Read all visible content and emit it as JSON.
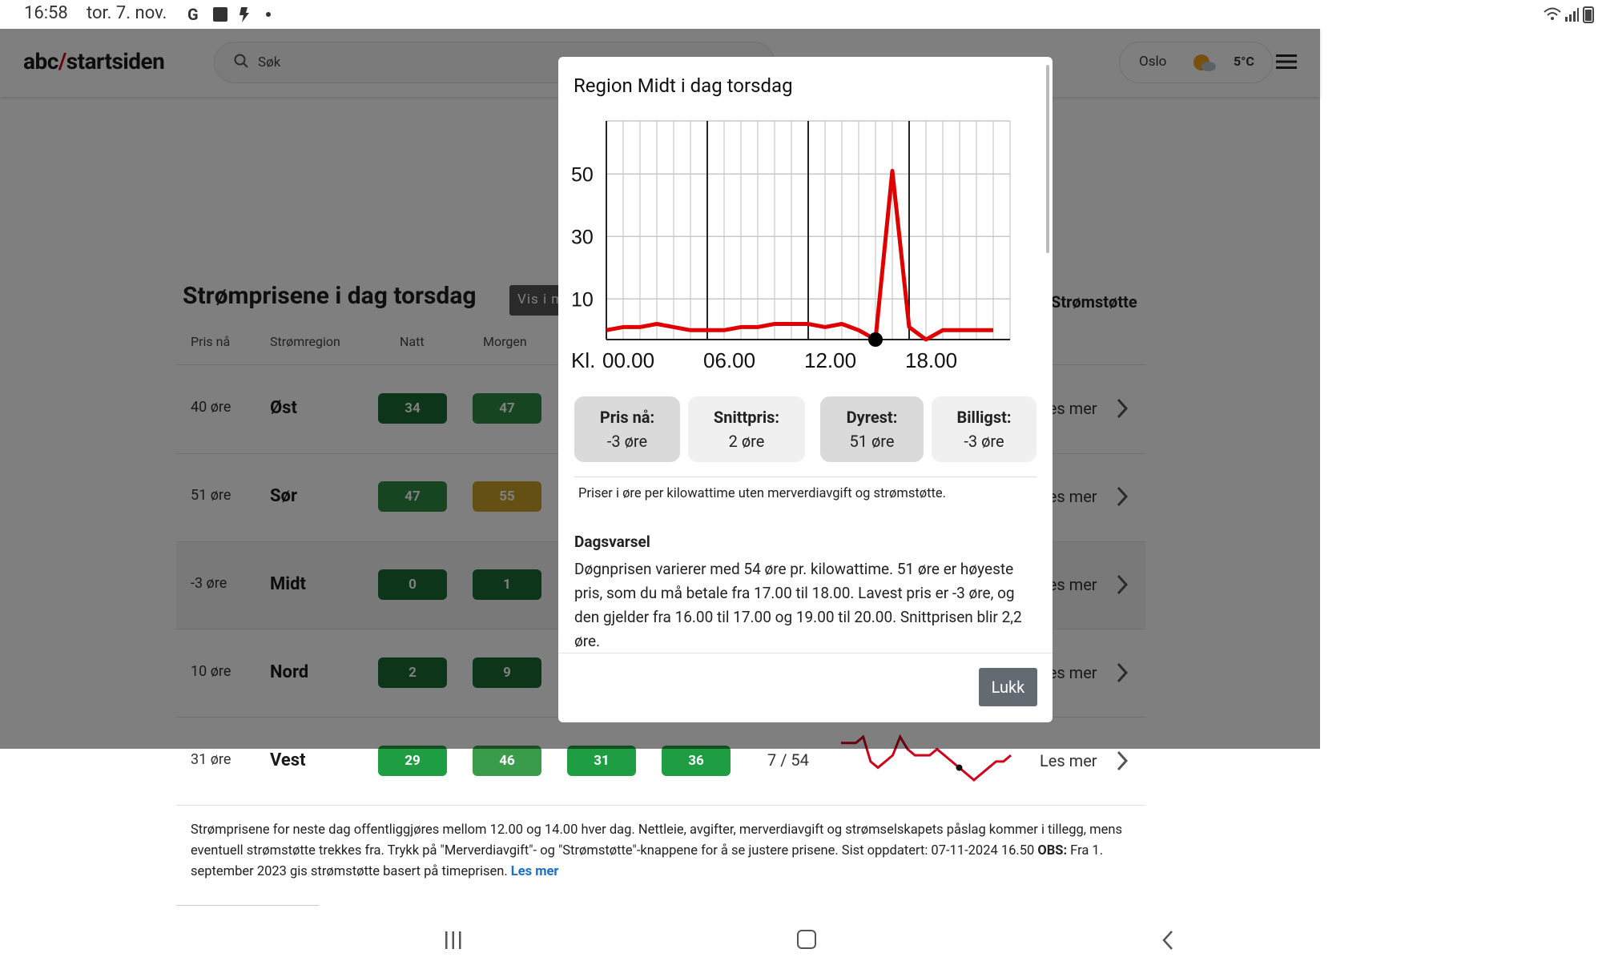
{
  "status_bar": {
    "time": "16:58",
    "date": "tor. 7. nov.",
    "icons": [
      "google-icon",
      "facebook-icon",
      "pin-icon",
      "dot-icon",
      "wifi-icon",
      "signal-icon",
      "battery-icon"
    ]
  },
  "header": {
    "logo_left": "abc",
    "logo_slash": "/",
    "logo_right": "startsiden",
    "search_label": "Søk",
    "weather": {
      "city": "Oslo",
      "temp": "5°C",
      "icon": "partly-sunny-icon"
    },
    "menu_icon": "hamburger-menu-icon"
  },
  "section": {
    "title": "Strømprisene i dag torsdag",
    "vis_button": "Vis i mva",
    "stromstotte_toggle": "Strømstøtte"
  },
  "table": {
    "columns": [
      "Pris nå",
      "Strømregion",
      "Natt",
      "Morgen"
    ],
    "rows": [
      {
        "price": "40  øre",
        "region": "Øst",
        "natt": "34",
        "morgen": "47",
        "les": "Les mer"
      },
      {
        "price": "51  øre",
        "region": "Sør",
        "natt": "47",
        "morgen": "55",
        "les": "Les mer"
      },
      {
        "price": "-3  øre",
        "region": "Midt",
        "natt": "0",
        "morgen": "1",
        "les": "Les mer"
      },
      {
        "price": "10  øre",
        "region": "Nord",
        "natt": "2",
        "morgen": "9",
        "les": "Les mer"
      },
      {
        "price": "31  øre",
        "region": "Vest",
        "natt": "29",
        "morgen": "46",
        "dag": "31",
        "kveld": "36",
        "minmax": "7 / 54",
        "les": "Les mer"
      }
    ],
    "pill_colors": {
      "dark_green": "#1a6b34",
      "green": "#2e8b43",
      "mid_green": "#3a9b4a",
      "bright_green": "#1f9d42",
      "amber": "#c8a12a"
    }
  },
  "footnote": {
    "text": "Strømprisene for neste dag offentliggjøres mellom 12.00 og 14.00 hver dag. Nettleie, avgifter, merverdiavgift og strømselskapets påslag kommer i tillegg, mens eventuell strømstøtte trekkes fra. Trykk på \"Merverdiavgift\"- og \"Strømstøtte\"-knappene for å se justere prisene. Sist oppdatert: 07-11-2024 16.50 ",
    "obs_label": "OBS:",
    "obs_text": " Fra 1. september 2023 gis strømstøtte basert på timeprisen. ",
    "link": "Les mer"
  },
  "modal": {
    "title": "Region Midt i dag torsdag",
    "stats": {
      "now_label": "Pris nå:",
      "now_value": "-3 øre",
      "avg_label": "Snittpris:",
      "avg_value": "2 øre",
      "max_label": "Dyrest:",
      "max_value": "51 øre",
      "min_label": "Billigst:",
      "min_value": "-3 øre"
    },
    "note": "Priser i øre per kilowattime uten merverdiavgift og strømstøtte.",
    "forecast_title": "Dagsvarsel",
    "forecast_text": "Døgnprisen varierer med 54 øre pr. kilowattime. 51 øre er høyeste pris, som du må betale fra 17.00 til 18.00. Lavest pris er -3 øre, og den gjelder fra 16.00 til 17.00 og 19.00 til 20.00. Snittprisen blir 2,2 øre.",
    "close_label": "Lukk"
  },
  "chart_data": {
    "type": "line",
    "x": [
      0,
      1,
      2,
      3,
      4,
      5,
      6,
      7,
      8,
      9,
      10,
      11,
      12,
      13,
      14,
      15,
      16,
      17,
      18,
      19,
      20,
      21,
      22,
      23
    ],
    "values": [
      0,
      1,
      1,
      2,
      1,
      0,
      0,
      0,
      1,
      1,
      2,
      2,
      2,
      1,
      2,
      0,
      -3,
      51,
      1,
      -3,
      0,
      0,
      0,
      0
    ],
    "series_color": "#e10000",
    "marker_hour": 16,
    "y_ticks": [
      "50",
      "30",
      "10"
    ],
    "y_tick_values": [
      50,
      30,
      10
    ],
    "ylim": [
      -3,
      67
    ],
    "xlim": [
      0,
      24
    ],
    "x_prefix": "Kl.",
    "x_ticks": [
      "00.00",
      "06.00",
      "12.00",
      "18.00"
    ],
    "x_tick_hours": [
      0,
      6,
      12,
      18
    ],
    "grid": true
  },
  "vest_sparkline": [
    46,
    46,
    46,
    47,
    43,
    42,
    43,
    44,
    47,
    45,
    44,
    44,
    44,
    45,
    44,
    43,
    42,
    41,
    40,
    41,
    42,
    43,
    43,
    44
  ]
}
